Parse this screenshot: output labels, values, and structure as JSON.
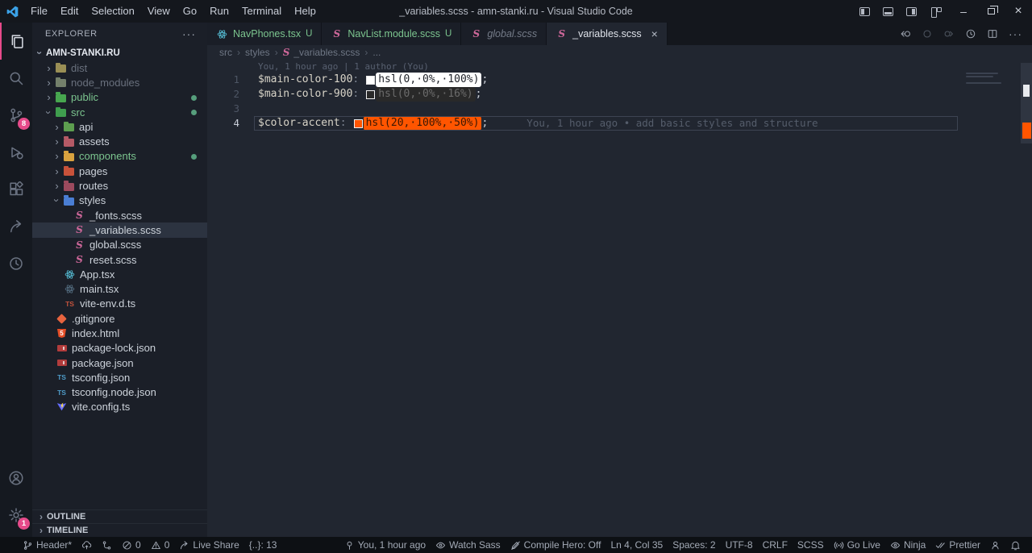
{
  "window": {
    "title": "_variables.scss - amn-stanki.ru - Visual Studio Code"
  },
  "titlebar": {
    "menus": [
      "File",
      "Edit",
      "Selection",
      "View",
      "Go",
      "Run",
      "Terminal",
      "Help"
    ],
    "window_controls": [
      "layout-sidebar-left-icon",
      "layout-panel-icon",
      "layout-sidebar-right-icon",
      "layout-customize-icon",
      "minimize-icon",
      "restore-icon",
      "close-icon"
    ]
  },
  "activity_bar": {
    "top": [
      {
        "name": "explorer",
        "icon": "files-icon",
        "active": true
      },
      {
        "name": "search",
        "icon": "search-icon"
      },
      {
        "name": "source-control",
        "icon": "source-control-icon",
        "badge": "8"
      },
      {
        "name": "run-debug",
        "icon": "debug-icon"
      },
      {
        "name": "extensions",
        "icon": "extensions-icon"
      },
      {
        "name": "live-share",
        "icon": "live-share-icon"
      },
      {
        "name": "gitlens",
        "icon": "history-icon"
      }
    ],
    "bottom": [
      {
        "name": "accounts",
        "icon": "account-icon"
      },
      {
        "name": "settings",
        "icon": "gear-icon",
        "badge": "1"
      }
    ]
  },
  "sidebar": {
    "title": "EXPLORER",
    "more": "···",
    "root": "AMN-STANKI.RU",
    "tree": [
      {
        "label": "dist",
        "level": 1,
        "kind": "folder",
        "chevron": "right",
        "icon": "folder",
        "icon_color": "#9a8f55",
        "style": "ignored"
      },
      {
        "label": "node_modules",
        "level": 1,
        "kind": "folder",
        "chevron": "right",
        "icon": "folder",
        "icon_color": "#74806b",
        "style": "ignored"
      },
      {
        "label": "public",
        "level": 1,
        "kind": "folder",
        "chevron": "right",
        "icon": "folder",
        "icon_color": "#47a64f",
        "style": "green",
        "dot": true
      },
      {
        "label": "src",
        "level": 1,
        "kind": "folder",
        "chevron": "down",
        "icon": "folder",
        "icon_color": "#3f9e4e",
        "style": "green",
        "dot": true
      },
      {
        "label": "api",
        "level": 2,
        "kind": "folder",
        "chevron": "right",
        "icon": "folder",
        "icon_color": "#5d9e4f"
      },
      {
        "label": "assets",
        "level": 2,
        "kind": "folder",
        "chevron": "right",
        "icon": "folder",
        "icon_color": "#b55a66"
      },
      {
        "label": "components",
        "level": 2,
        "kind": "folder",
        "chevron": "right",
        "icon": "folder",
        "icon_color": "#d9a23f",
        "style": "green",
        "dot": true
      },
      {
        "label": "pages",
        "level": 2,
        "kind": "folder",
        "chevron": "right",
        "icon": "folder",
        "icon_color": "#c8523a"
      },
      {
        "label": "routes",
        "level": 2,
        "kind": "folder",
        "chevron": "right",
        "icon": "folder",
        "icon_color": "#9c4a5e"
      },
      {
        "label": "styles",
        "level": 2,
        "kind": "folder",
        "chevron": "down",
        "icon": "folder",
        "icon_color": "#4a7ed4"
      },
      {
        "label": "_fonts.scss",
        "level": 3,
        "kind": "file",
        "icon": "sass"
      },
      {
        "label": "_variables.scss",
        "level": 3,
        "kind": "file",
        "icon": "sass",
        "selected": true
      },
      {
        "label": "global.scss",
        "level": 3,
        "kind": "file",
        "icon": "sass"
      },
      {
        "label": "reset.scss",
        "level": 3,
        "kind": "file",
        "icon": "sass"
      },
      {
        "label": "App.tsx",
        "level": 2,
        "kind": "file",
        "icon": "react"
      },
      {
        "label": "main.tsx",
        "level": 2,
        "kind": "file",
        "icon": "react-dim"
      },
      {
        "label": "vite-env.d.ts",
        "level": 2,
        "kind": "file",
        "icon": "ts-red"
      },
      {
        "label": ".gitignore",
        "level": 1,
        "kind": "file",
        "icon": "git"
      },
      {
        "label": "index.html",
        "level": 1,
        "kind": "file",
        "icon": "html"
      },
      {
        "label": "package-lock.json",
        "level": 1,
        "kind": "file",
        "icon": "npm"
      },
      {
        "label": "package.json",
        "level": 1,
        "kind": "file",
        "icon": "npm"
      },
      {
        "label": "tsconfig.json",
        "level": 1,
        "kind": "file",
        "icon": "ts-blue"
      },
      {
        "label": "tsconfig.node.json",
        "level": 1,
        "kind": "file",
        "icon": "ts-blue"
      },
      {
        "label": "vite.config.ts",
        "level": 1,
        "kind": "file",
        "icon": "vite"
      }
    ],
    "sections": [
      "OUTLINE",
      "TIMELINE"
    ]
  },
  "tabs": [
    {
      "label": "NavPhones.tsx",
      "icon": "react",
      "badge": "U",
      "state": "untracked"
    },
    {
      "label": "NavList.module.scss",
      "icon": "sass",
      "badge": "U",
      "state": "untracked"
    },
    {
      "label": "global.scss",
      "icon": "sass",
      "state": "preview"
    },
    {
      "label": "_variables.scss",
      "icon": "sass",
      "state": "active",
      "close": "×"
    }
  ],
  "editor_actions": [
    {
      "name": "open-changes",
      "icon": "open-changes-icon"
    },
    {
      "name": "previous-change",
      "icon": "prev-change-icon",
      "dim": true
    },
    {
      "name": "next-change",
      "icon": "next-change-icon",
      "dim": true
    },
    {
      "name": "file-history",
      "icon": "file-history-icon"
    },
    {
      "name": "split-editor",
      "icon": "split-editor-icon"
    },
    {
      "name": "more-actions",
      "icon": "more-actions-icon",
      "glyph": "···"
    }
  ],
  "breadcrumbs": {
    "separator": "›",
    "items": [
      {
        "label": "src"
      },
      {
        "label": "styles"
      },
      {
        "label": "_variables.scss",
        "icon": "sass"
      },
      {
        "label": "..."
      }
    ]
  },
  "editor": {
    "codelens": "You, 1 hour ago | 1 author (You)",
    "lines": [
      {
        "num": "1",
        "name": "$main-color-100",
        "colon": ":",
        "value": "hsl(0,·0%,·100%)",
        "semi": ";",
        "swatch": "#ffffff",
        "swatch_border": "#e8e8e8",
        "value_bg": "#ffffff",
        "value_fg": "#1d2027"
      },
      {
        "num": "2",
        "name": "$main-color-900",
        "colon": ":",
        "value": "hsl(0,·0%,·16%)",
        "semi": ";",
        "swatch": "#292929",
        "swatch_border": "#f0f0f0",
        "value_bg": "#292929",
        "value_fg": "#6b6b6b"
      },
      {
        "num": "3"
      },
      {
        "num": "4",
        "name": "$color-accent",
        "colon": ":",
        "value": "hsl(20,·100%,·50%)",
        "semi": ";",
        "swatch": "#ff5500",
        "swatch_border": "#f0f0f0",
        "value_bg": "#ff5500",
        "value_fg": "#3a1804",
        "blame": "You, 1 hour ago • add basic styles and structure",
        "current": true
      }
    ]
  },
  "status_bar": {
    "left": [
      {
        "name": "branch-status",
        "icon": "git-branch-icon",
        "label": "Header*"
      },
      {
        "name": "publish-status",
        "icon": "cloud-upload-icon",
        "label": ""
      },
      {
        "name": "git-graph-status",
        "icon": "git-graph-icon",
        "label": ""
      },
      {
        "name": "errors-status",
        "icon": "error-icon",
        "label": "0"
      },
      {
        "name": "warnings-status",
        "icon": "warning-icon",
        "label": "0"
      },
      {
        "name": "live-share-status",
        "icon": "live-share-icon",
        "label": "Live Share"
      },
      {
        "name": "brace-count-status",
        "icon": "",
        "label": "{..}: 13"
      }
    ],
    "right": [
      {
        "name": "blame-status",
        "icon": "blame-pin-icon",
        "label": "You, 1 hour ago"
      },
      {
        "name": "watch-sass-status",
        "icon": "eye-icon",
        "label": "Watch Sass"
      },
      {
        "name": "compile-hero-status",
        "icon": "pencil-slash-icon",
        "label": "Compile Hero: Off"
      },
      {
        "name": "cursor-position",
        "icon": "",
        "label": "Ln 4, Col 35"
      },
      {
        "name": "indentation",
        "icon": "",
        "label": "Spaces: 2"
      },
      {
        "name": "encoding",
        "icon": "",
        "label": "UTF-8"
      },
      {
        "name": "eol-sequence",
        "icon": "",
        "label": "CRLF"
      },
      {
        "name": "language-mode",
        "icon": "",
        "label": "SCSS"
      },
      {
        "name": "go-live-status",
        "icon": "broadcast-icon",
        "label": "Go Live"
      },
      {
        "name": "ninja-status",
        "icon": "eye-icon",
        "label": "Ninja"
      },
      {
        "name": "prettier-status",
        "icon": "double-check-icon",
        "label": "Prettier"
      },
      {
        "name": "feedback",
        "icon": "feedback-icon",
        "label": ""
      },
      {
        "name": "notifications",
        "icon": "bell-icon",
        "label": ""
      }
    ]
  },
  "colors": {
    "accent_pink": "#e64a8a",
    "git_green": "#7cc58f",
    "sass_pink": "#cd6799",
    "accent_orange": "#ff5500",
    "swatch_white": "#ffffff",
    "swatch_dark": "#292929"
  }
}
